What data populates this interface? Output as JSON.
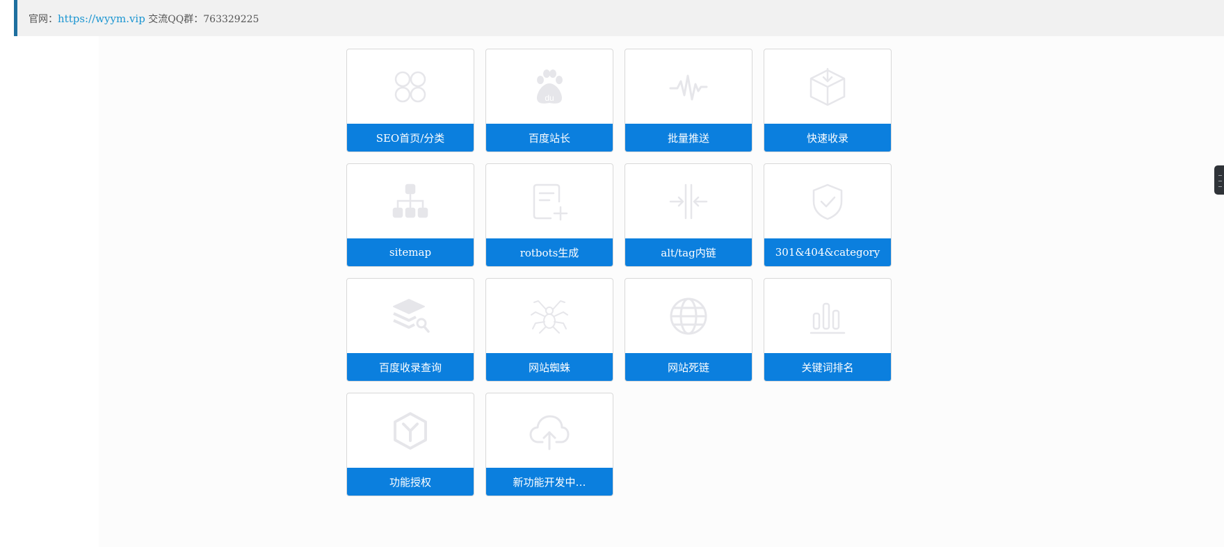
{
  "header": {
    "site_label": "官网：",
    "site_url": "https://wyym.vip",
    "qq_label": " 交流QQ群：763329225"
  },
  "colors": {
    "accent": "#0b7fde",
    "link": "#1a95d1",
    "icon_gray": "#e6e6ea",
    "header_border": "#1e6f9f"
  },
  "cards": [
    {
      "label": "SEO首页/分类",
      "icon": "clover-icon"
    },
    {
      "label": "百度站长",
      "icon": "baidu-paw-icon"
    },
    {
      "label": "批量推送",
      "icon": "pulse-icon"
    },
    {
      "label": "快速收录",
      "icon": "box-download-icon"
    },
    {
      "label": "sitemap",
      "icon": "sitemap-icon"
    },
    {
      "label": "rotbots生成",
      "icon": "document-add-icon"
    },
    {
      "label": "alt/tag内链",
      "icon": "merge-arrows-icon"
    },
    {
      "label": "301&404&category",
      "icon": "shield-check-icon"
    },
    {
      "label": "百度收录查询",
      "icon": "layers-search-icon"
    },
    {
      "label": "网站蜘蛛",
      "icon": "spider-icon"
    },
    {
      "label": "网站死链",
      "icon": "globe-icon"
    },
    {
      "label": "关键词排名",
      "icon": "bar-chart-icon"
    },
    {
      "label": "功能授权",
      "icon": "hexagon-icon"
    },
    {
      "label": "新功能开发中…",
      "icon": "cloud-upload-icon"
    }
  ]
}
